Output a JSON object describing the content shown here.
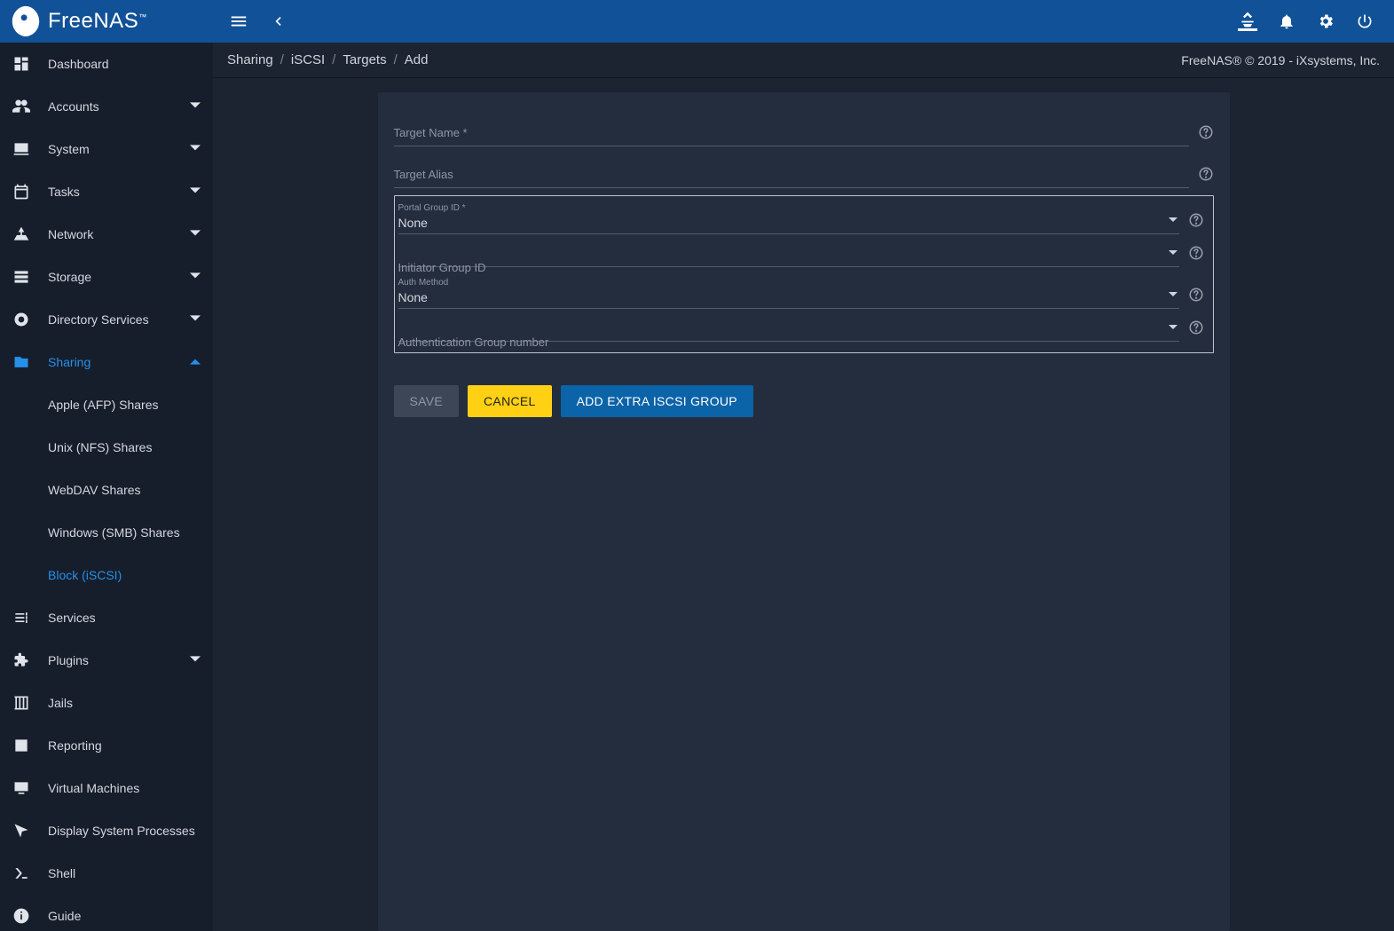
{
  "brand": {
    "name": "FreeNAS",
    "tm": "™"
  },
  "topbar": {
    "icons": {
      "menu": "menu-icon",
      "collapse": "chevron-left-icon",
      "theme": "palette-icon",
      "notifications": "bell-icon",
      "settings": "gear-icon",
      "power": "power-icon"
    }
  },
  "breadcrumb": {
    "items": [
      "Sharing",
      "iSCSI",
      "Targets",
      "Add"
    ],
    "right": "FreeNAS® © 2019 - iXsystems, Inc."
  },
  "sidebar": {
    "items": [
      {
        "label": "Dashboard",
        "icon": "dashboard",
        "expandable": false
      },
      {
        "label": "Accounts",
        "icon": "accounts",
        "expandable": true
      },
      {
        "label": "System",
        "icon": "system",
        "expandable": true
      },
      {
        "label": "Tasks",
        "icon": "tasks",
        "expandable": true
      },
      {
        "label": "Network",
        "icon": "network",
        "expandable": true
      },
      {
        "label": "Storage",
        "icon": "storage",
        "expandable": true
      },
      {
        "label": "Directory Services",
        "icon": "directory",
        "expandable": true
      },
      {
        "label": "Sharing",
        "icon": "sharing",
        "expandable": true,
        "active": true,
        "children": [
          {
            "label": "Apple (AFP) Shares"
          },
          {
            "label": "Unix (NFS) Shares"
          },
          {
            "label": "WebDAV Shares"
          },
          {
            "label": "Windows (SMB) Shares"
          },
          {
            "label": "Block (iSCSI)",
            "active": true
          }
        ]
      },
      {
        "label": "Services",
        "icon": "services",
        "expandable": false
      },
      {
        "label": "Plugins",
        "icon": "plugins",
        "expandable": true
      },
      {
        "label": "Jails",
        "icon": "jails",
        "expandable": false
      },
      {
        "label": "Reporting",
        "icon": "reporting",
        "expandable": false
      },
      {
        "label": "Virtual Machines",
        "icon": "vm",
        "expandable": false
      },
      {
        "label": "Display System Processes",
        "icon": "processes",
        "expandable": false
      },
      {
        "label": "Shell",
        "icon": "shell",
        "expandable": false
      },
      {
        "label": "Guide",
        "icon": "guide",
        "expandable": false
      }
    ]
  },
  "form": {
    "target_name": {
      "label": "Target Name *",
      "value": ""
    },
    "target_alias": {
      "label": "Target Alias",
      "value": ""
    },
    "groups": [
      {
        "portal_group": {
          "label": "Portal Group ID *",
          "value": "None"
        },
        "initiator_group": {
          "label": "Initiator Group ID",
          "value": ""
        },
        "auth_method": {
          "label": "Auth Method",
          "value": "None"
        },
        "auth_group": {
          "label": "Authentication Group number",
          "value": ""
        }
      }
    ],
    "buttons": {
      "save": "SAVE",
      "cancel": "CANCEL",
      "add_group": "ADD EXTRA ISCSI GROUP"
    }
  }
}
